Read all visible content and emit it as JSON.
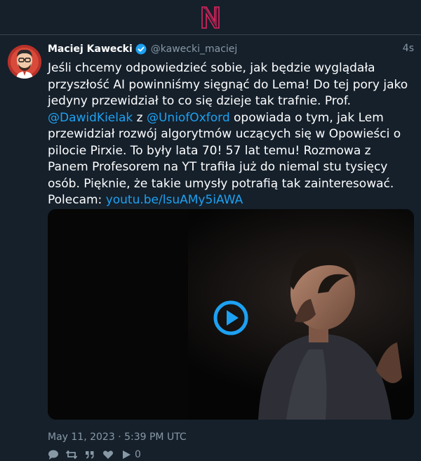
{
  "brand": {
    "logo_letter": "N",
    "logo_color": "#e0245e"
  },
  "tweet": {
    "author_name": "Maciej Kawecki",
    "handle": "@kawecki_maciej",
    "time_ago": "4s",
    "verified": true,
    "text_before_mention1": "Jeśli chcemy odpowiedzieć sobie, jak będzie wyglądała przyszłość AI powinniśmy sięgnąć do Lema! Do tej pory jako jedyny przewidział to co się dzieje tak trafnie. Prof. ",
    "mention1": "@DawidKielak",
    "text_between_mentions": " z ",
    "mention2": "@UniofOxford",
    "text_after_mention2": " opowiada o tym, jak Lem przewidział rozwój algorytmów uczących się w Opowieści o pilocie Pirxie. To były lata 70! 57 lat temu! Rozmowa z Panem Profesorem na YT trafiła już do niemal stu tysięcy osób. Pięknie, że takie umysły potrafią tak zainteresować. Polecam: ",
    "link": "youtu.be/lsuAMy5iAWA",
    "timestamp": "May 11, 2023 · 5:39 PM UTC",
    "play_count": "0"
  },
  "colors": {
    "background": "#15202b",
    "accent": "#1da1f2",
    "muted": "#8899a6",
    "border": "#38444d"
  }
}
